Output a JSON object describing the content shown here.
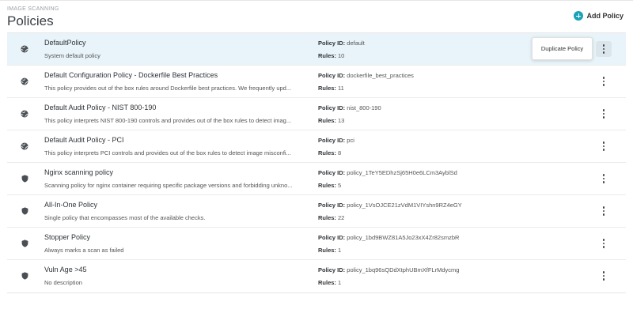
{
  "header": {
    "eyebrow": "IMAGE SCANNING",
    "title": "Policies",
    "add_label": "Add Policy"
  },
  "tooltip": "Duplicate Policy",
  "labels": {
    "policy_id": "Policy ID:",
    "rules": "Rules:"
  },
  "policies": [
    {
      "icon": "globe-icon",
      "name": "DefaultPolicy",
      "description": "System default policy",
      "policy_id": "default",
      "rules": "10"
    },
    {
      "icon": "globe-icon",
      "name": "Default Configuration Policy - Dockerfile Best Practices",
      "description": "This policy provides out of the box rules around Dockerfile best practices. We frequently upd...",
      "policy_id": "dockerfile_best_practices",
      "rules": "11"
    },
    {
      "icon": "globe-icon",
      "name": "Default Audit Policy - NIST 800-190",
      "description": "This policy interprets NIST 800-190 controls and provides out of the box rules to detect imag...",
      "policy_id": "nist_800-190",
      "rules": "13"
    },
    {
      "icon": "globe-icon",
      "name": "Default Audit Policy - PCI",
      "description": "This policy interprets PCI controls and provides out of the box rules to detect image misconfi...",
      "policy_id": "pci",
      "rules": "8"
    },
    {
      "icon": "shield-icon",
      "name": "Nginx scanning policy",
      "description": "Scanning policy for nginx container requiring specific package versions and forbidding unkno...",
      "policy_id": "policy_1TeY5EDhzSj65H0e6LCm3AyblSd",
      "rules": "5"
    },
    {
      "icon": "shield-icon",
      "name": "All-In-One Policy",
      "description": "Single policy that encompasses most of the available checks.",
      "policy_id": "policy_1VsOJCE21zVdM1VIYshn9RZ4eGY",
      "rules": "22"
    },
    {
      "icon": "shield-icon",
      "name": "Stopper Policy",
      "description": "Always marks a scan as failed",
      "policy_id": "policy_1bd9BWZ81A5Jo23xX4Zr82smzbR",
      "rules": "1"
    },
    {
      "icon": "shield-icon",
      "name": "Vuln Age >45",
      "description": "No description",
      "policy_id": "policy_1bq96sQDdXtphUBmXfFLrMdycmg",
      "rules": "1"
    }
  ]
}
